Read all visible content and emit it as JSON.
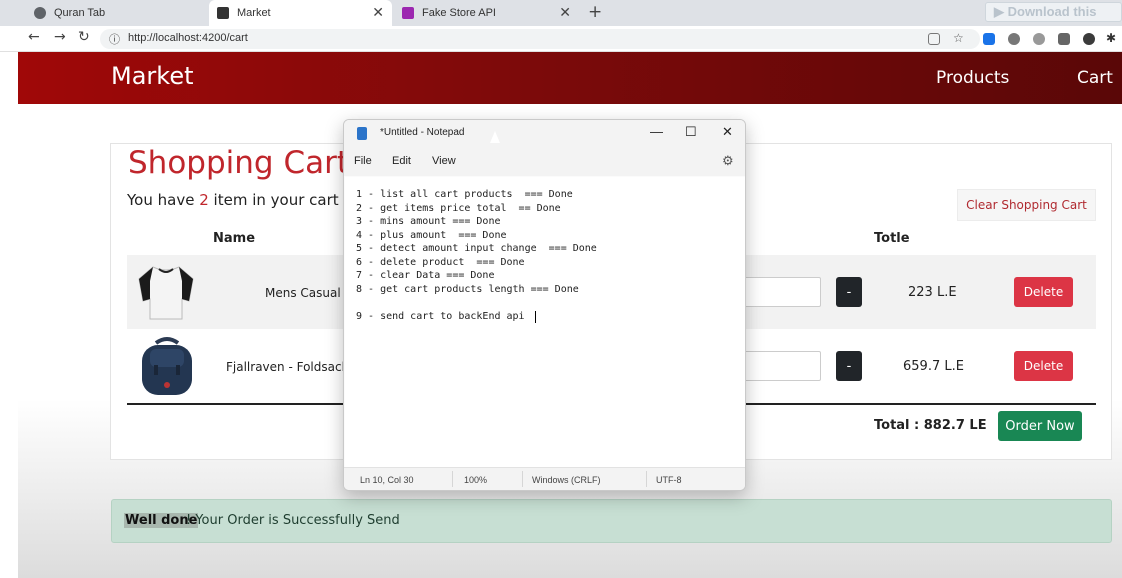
{
  "browser": {
    "tabs": [
      {
        "title": "Quran Tab",
        "icon": "globe-icon",
        "color": "#5f6368"
      },
      {
        "title": "Market",
        "icon": "angular-icon",
        "color": "#333333"
      },
      {
        "title": "Fake Store API",
        "icon": "fakestore-icon",
        "color": "#9c27b0"
      }
    ],
    "new_tab": "+",
    "close_glyph": "✕",
    "url": "http://localhost:4200/cart",
    "extension_button": "▶ Download this",
    "nav": {
      "back": "←",
      "forward": "→",
      "reload": "↻",
      "info": "ⓘ"
    }
  },
  "app": {
    "brand": "Market",
    "nav_links": [
      "Products",
      "Cart"
    ],
    "cart": {
      "title": "Shopping Cart",
      "summary_prefix": "You have",
      "count": "2",
      "summary_suffix": "item in your cart",
      "clear_label": "Clear Shopping Cart",
      "headers": {
        "name": "Name",
        "total": "Totle"
      },
      "items": [
        {
          "name": "Mens Casual P",
          "price": "223 L.E",
          "minus": "-",
          "delete": "Delete",
          "image": "raglan-shirt-icon"
        },
        {
          "name": "Fjallraven - Foldsack",
          "price": "659.7 L.E",
          "minus": "-",
          "delete": "Delete",
          "image": "backpack-icon"
        }
      ],
      "total_label": "Total :  882.7 LE",
      "order_label": "Order Now"
    },
    "alert": {
      "strong": "Well done",
      "text": "! Your Order is Successfully Send"
    }
  },
  "notepad": {
    "title": "*Untitled - Notepad",
    "controls": {
      "minimize": "—",
      "maximize": "☐",
      "close": "✕"
    },
    "menu": [
      "File",
      "Edit",
      "View"
    ],
    "lines": [
      "1 - list all cart products  === Done",
      "2 - get items price total  == Done",
      "3 - mins amount === Done",
      "4 - plus amount  === Done",
      "5 - detect amount input change  === Done",
      "6 - delete product  === Done",
      "7 - clear Data === Done",
      "8 - get cart products length === Done",
      "",
      "9 - send cart to backEnd api"
    ],
    "status": {
      "position": "Ln 10, Col 30",
      "zoom": "100%",
      "line_ending": "Windows (CRLF)",
      "encoding": "UTF-8"
    }
  },
  "colors": {
    "navbar": "#8b0a0a",
    "accent": "#c0262c",
    "danger": "#dc3545",
    "success": "#198754"
  }
}
